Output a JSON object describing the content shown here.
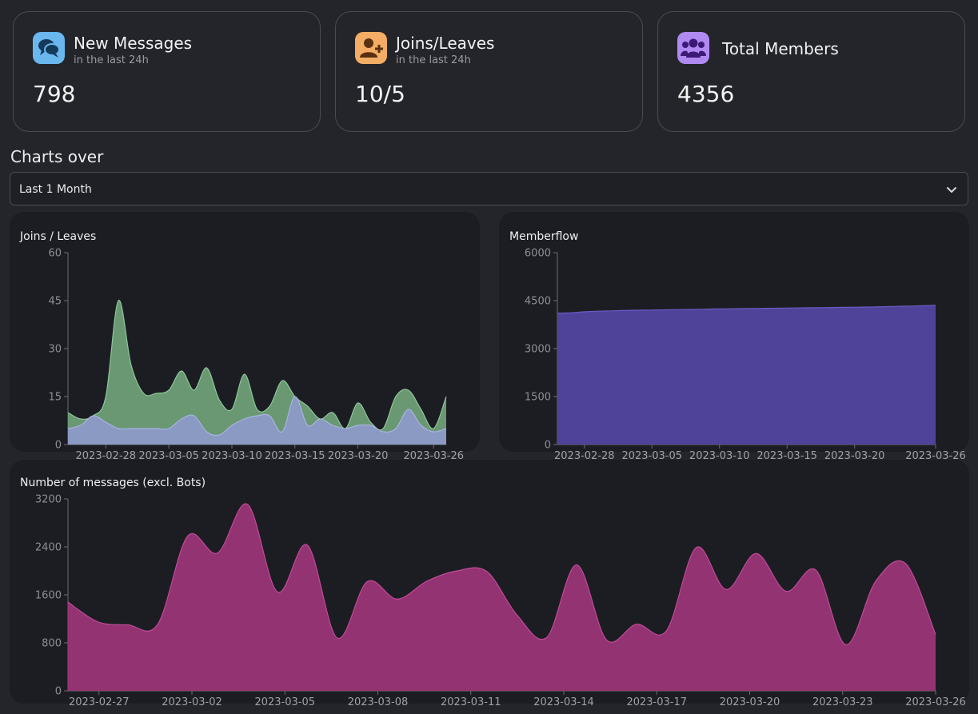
{
  "stats": [
    {
      "title": "New Messages",
      "subtitle": "in the last 24h",
      "value": "798",
      "icon": "chat-bubbles-icon",
      "icon_color": "#6ab7ee"
    },
    {
      "title": "Joins/Leaves",
      "subtitle": "in the last 24h",
      "value": "10/5",
      "icon": "user-add-icon",
      "icon_color": "#f3ad64"
    },
    {
      "title": "Total Members",
      "subtitle": "",
      "value": "4356",
      "icon": "users-group-icon",
      "icon_color": "#b08af0"
    }
  ],
  "charts_over": {
    "label": "Charts over",
    "selected": "Last 1 Month",
    "icon": "chevron-down-icon"
  },
  "colors": {
    "joins": "#6e9f78",
    "leaves": "#8d9ac7",
    "memberflow": "#5245a0",
    "messages": "#9a3577"
  },
  "chart_data": [
    {
      "type": "area",
      "title": "Joins / Leaves",
      "x_start": "2023-02-25",
      "x": [
        "2023-02-25",
        "2023-02-26",
        "2023-02-27",
        "2023-02-28",
        "2023-03-01",
        "2023-03-02",
        "2023-03-03",
        "2023-03-04",
        "2023-03-05",
        "2023-03-06",
        "2023-03-07",
        "2023-03-08",
        "2023-03-09",
        "2023-03-10",
        "2023-03-11",
        "2023-03-12",
        "2023-03-13",
        "2023-03-14",
        "2023-03-15",
        "2023-03-16",
        "2023-03-17",
        "2023-03-18",
        "2023-03-19",
        "2023-03-20",
        "2023-03-21",
        "2023-03-22",
        "2023-03-23",
        "2023-03-24",
        "2023-03-25",
        "2023-03-26",
        "2023-03-27"
      ],
      "series": [
        {
          "name": "Joins",
          "values": [
            10,
            8,
            9,
            15,
            45,
            25,
            16,
            16,
            17,
            23,
            17,
            24,
            14,
            11,
            22,
            11,
            12,
            20,
            15,
            12,
            8,
            10,
            5,
            13,
            7,
            5,
            15,
            17,
            11,
            5,
            15
          ]
        },
        {
          "name": "Leaves",
          "values": [
            5,
            6,
            9,
            7,
            5,
            5,
            5,
            5,
            5,
            8,
            9,
            4,
            3,
            6,
            8,
            9,
            9,
            4,
            15,
            6,
            8,
            6,
            5,
            6,
            6,
            4,
            5,
            11,
            6,
            4,
            5
          ]
        }
      ],
      "ylim": [
        0,
        60
      ],
      "yticks": [
        0,
        15,
        30,
        45,
        60
      ],
      "xticks": [
        "2023-02-28",
        "2023-03-05",
        "2023-03-10",
        "2023-03-15",
        "2023-03-20",
        "2023-03-26"
      ],
      "grid": false
    },
    {
      "type": "area",
      "title": "Memberflow",
      "x_start": "2023-02-26",
      "x_end": "2023-03-26",
      "series": [
        {
          "values": [
            4110,
            4120,
            4150,
            4170,
            4180,
            4190,
            4200,
            4205,
            4210,
            4220,
            4225,
            4230,
            4240,
            4245,
            4250,
            4255,
            4260,
            4265,
            4270,
            4275,
            4280,
            4285,
            4290,
            4295,
            4300,
            4310,
            4320,
            4330,
            4340,
            4356
          ]
        }
      ],
      "ylim": [
        0,
        6000
      ],
      "yticks": [
        0,
        1500,
        3000,
        4500,
        6000
      ],
      "xticks": [
        "2023-02-28",
        "2023-03-05",
        "2023-03-10",
        "2023-03-15",
        "2023-03-20",
        "2023-03-26"
      ],
      "grid": false
    },
    {
      "type": "area",
      "title": "Number of messages (excl. Bots)",
      "x_start": "2023-02-26",
      "x_end": "2023-03-26",
      "series": [
        {
          "values": [
            1480,
            1150,
            1100,
            1110,
            2580,
            2300,
            3110,
            1650,
            2430,
            880,
            1820,
            1530,
            1830,
            2000,
            1990,
            1270,
            890,
            2100,
            850,
            1110,
            1000,
            2390,
            1690,
            2290,
            1660,
            2010,
            770,
            1830,
            2120,
            940
          ]
        }
      ],
      "ylim": [
        0,
        3200
      ],
      "yticks": [
        0,
        800,
        1600,
        2400,
        3200
      ],
      "xticks": [
        "2023-02-27",
        "2023-03-02",
        "2023-03-05",
        "2023-03-08",
        "2023-03-11",
        "2023-03-14",
        "2023-03-17",
        "2023-03-20",
        "2023-03-23",
        "2023-03-26"
      ],
      "grid": false
    }
  ]
}
